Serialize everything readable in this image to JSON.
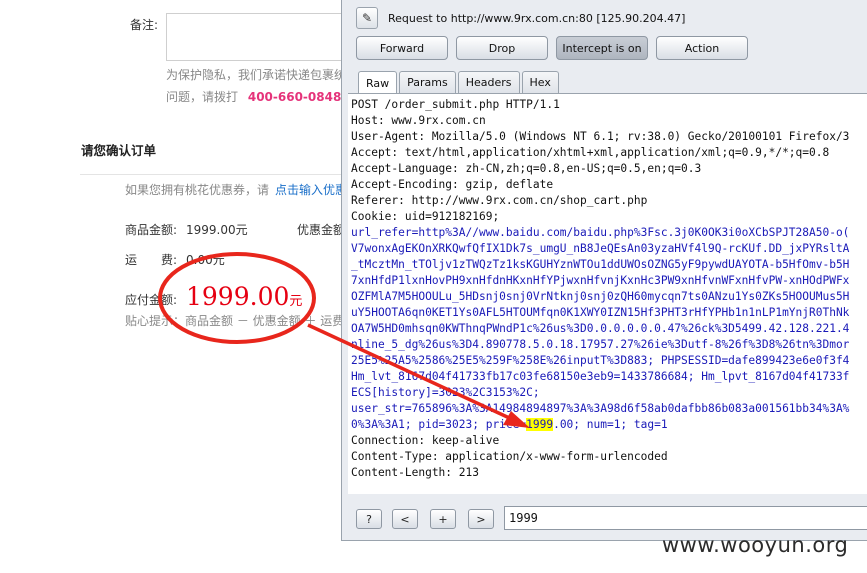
{
  "webpage": {
    "memo_label": "备注:",
    "privacy_note_1": "为保护隐私，我们承诺快递包裹统",
    "privacy_note_2": "问题，请拨打",
    "phone": "400-660-0848",
    "privacy_note_2_tail": "（",
    "confirm_title": "请您确认订单",
    "coupon_text": "如果您拥有桃花优惠券，请",
    "coupon_link": "点击输入优惠",
    "goods_amount_label": "商品金额:",
    "goods_amount_value": "1999.00元",
    "discount_label": "优惠金额",
    "shipping_label": "运　　费:",
    "shipping_value": "0.00元",
    "payable_label": "应付金额:",
    "payable_value": "1999.00",
    "payable_unit": "元",
    "tip_text": "贴心提示：商品金额 － 优惠金额 ＋ 运费"
  },
  "burp": {
    "request_line": "Request to http://www.9rx.com.cn:80  [125.90.204.47]",
    "buttons": [
      "Forward",
      "Drop",
      "Intercept is on",
      "Action"
    ],
    "active_button_index": 2,
    "tabs": [
      "Raw",
      "Params",
      "Headers",
      "Hex"
    ],
    "active_tab_index": 0,
    "request_lines": [
      {
        "text": "POST /order_submit.php HTTP/1.1",
        "color": "black"
      },
      {
        "text": "Host: www.9rx.com.cn",
        "color": "black"
      },
      {
        "text": "User-Agent: Mozilla/5.0 (Windows NT 6.1; rv:38.0) Gecko/20100101 Firefox/3",
        "color": "black"
      },
      {
        "text": "Accept: text/html,application/xhtml+xml,application/xml;q=0.9,*/*;q=0.8",
        "color": "black"
      },
      {
        "text": "Accept-Language: zh-CN,zh;q=0.8,en-US;q=0.5,en;q=0.3",
        "color": "black"
      },
      {
        "text": "Accept-Encoding: gzip, deflate",
        "color": "black"
      },
      {
        "text": "Referer: http://www.9rx.com.cn/shop_cart.php",
        "color": "black"
      },
      {
        "text": "Cookie: uid=912182169;",
        "color": "black"
      },
      {
        "text": "url_refer=http%3A//www.baidu.com/baidu.php%3Fsc.3j0K0OK3i0oXCbSPJT28A50-o(",
        "color": "blue"
      },
      {
        "text": "V7wonxAgEKOnXRKQwfQfIX1Dk7s_umgU_nB8JeQEsAn03yzaHVf4l9Q-rcKUf.DD_jxPYRsltA",
        "color": "blue"
      },
      {
        "text": "_tMcztMn_tTOljv1zTWQzTz1ksKGUHYznWTOu1ddUWOsOZNG5yF9pywdUAYOTA-b5HfOmv-b5H",
        "color": "blue"
      },
      {
        "text": "7xnHfdP1lxnHovPH9xnHfdnHKxnHfYPjwxnHfvnjKxnHc3PW9xnHfvnWFxnHfvPW-xnHOdPWFx",
        "color": "blue"
      },
      {
        "text": "OZFMlA7M5HOOULu_5HDsnj0snj0VrNtknj0snj0zQH60mycqn7ts0ANzu1Ys0ZKs5HOOUMus5H",
        "color": "blue"
      },
      {
        "text": "uY5HOOTA6qn0KET1Ys0AFL5HTOUMfqn0K1XWY0IZN15Hf3PHT3rHfYPHb1n1nLP1mYnjR0ThNk",
        "color": "blue"
      },
      {
        "text": "OA7W5HD0mhsqn0KWThnqPWndP1c%26us%3D0.0.0.0.0.0.47%26ck%3D5499.42.128.221.4",
        "color": "blue"
      },
      {
        "text": "nline_5_dg%26us%3D4.890778.5.0.18.17957.27%26ie%3Dutf-8%26f%3D8%26tn%3Dmor",
        "color": "blue"
      },
      {
        "text": "25E5%25A5%2586%25E5%259F%258E%26inputT%3D883; PHPSESSID=dafe899423e6e0f3f4",
        "color": "blue"
      },
      {
        "text": "Hm_lvt_8167d04f41733fb17c03fe68150e3eb9=1433786684; Hm_lpvt_8167d04f41733f",
        "color": "blue"
      },
      {
        "text": "ECS[history]=3023%2C3153%2C;",
        "color": "blue"
      },
      {
        "text": "user_str=765896%3A%3A14984894897%3A%3A98d6f58ab0dafbb86b083a001561bb34%3A%",
        "color": "blue"
      },
      {
        "text": "0%3A%3A1; pid=3023; price=1999.00; num=1; tag=1",
        "color": "blue"
      },
      {
        "text": "Connection: keep-alive",
        "color": "black"
      },
      {
        "text": "Content-Type: application/x-www-form-urlencoded",
        "color": "black"
      },
      {
        "text": "Content-Length: 213",
        "color": "black"
      }
    ],
    "bottom_buttons": [
      "?",
      "<",
      "+",
      ">"
    ],
    "search_value": "1999"
  },
  "annotation": {
    "color": "#e8261c"
  },
  "watermark": "www.wooyun.org"
}
